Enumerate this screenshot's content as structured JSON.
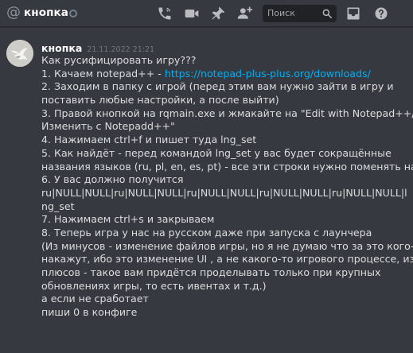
{
  "header": {
    "channel_name": "кнопка",
    "search_placeholder": "Поиск",
    "icons": [
      "at-icon",
      "status-icon",
      "call-icon",
      "video-icon",
      "pin-icon",
      "add-friend-icon",
      "search-icon",
      "inbox-icon",
      "help-icon"
    ],
    "colors": {
      "background": "#36393f",
      "search_bg": "#202225",
      "icon": "#b9bbbe"
    }
  },
  "message": {
    "username": "кнопка",
    "timestamp": "21.11.2022 21:21",
    "link_color": "#00aff4",
    "lines": [
      {
        "text": "Как русифицировать игру???"
      },
      {
        "text": "1. Качаем notepad++ - ",
        "link": "https://notepad-plus-plus.org/downloads/"
      },
      {
        "text": "2. Заходим в папку с игрой (перед этим вам нужно зайти в игру и"
      },
      {
        "text": "поставить любые настройки, а после выйти)"
      },
      {
        "text": "3. Правой кнопкой на rqmain.exe и жмакайте на \"Edit with Notepad++/"
      },
      {
        "text": "Изменить с Notepadd++\""
      },
      {
        "text": "4. Нажимаем ctrl+f и пишет туда lng_set"
      },
      {
        "text": "5. Как найдёт - перед  командой lng_set у вас будет сокращённые"
      },
      {
        "text": "названия языков (ru, pl, en, es, pt) - все эти строки нужно поменять на ru"
      },
      {
        "text": "6. У вас должно получится"
      },
      {
        "text": "ru|NULL|NULL|ru|NULL|NULL|ru|NULL|NULL|ru|NULL|NULL|ru|NULL|NULL|l"
      },
      {
        "text": "ng_set"
      },
      {
        "text": "7. Нажимаем ctrl+s и закрываем"
      },
      {
        "text": "8. Теперь игра у нас на русском даже при запуска с лаунчера"
      },
      {
        "text": "(Из минусов - изменение файлов игры, но я не думаю что за это кого-то"
      },
      {
        "text": "накажут, ибо это изменение UI , а не какого-то игрового процессе, из"
      },
      {
        "text": "плюсов - такое вам придётся проделывать только при крупных"
      },
      {
        "text": "обновлениях игры, то есть ивентах и т.д.)"
      },
      {
        "text": "а если не сработает"
      },
      {
        "text": "пиши 0 в конфиге"
      }
    ]
  }
}
